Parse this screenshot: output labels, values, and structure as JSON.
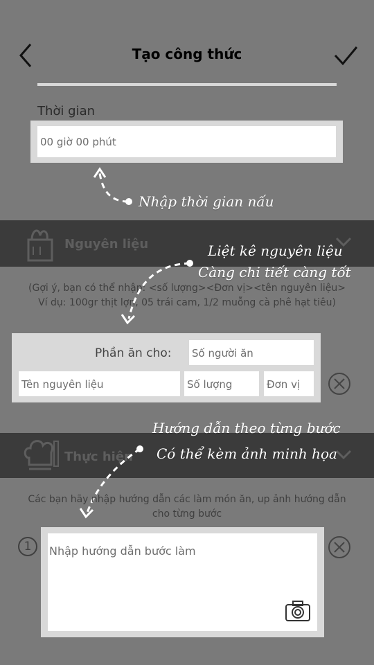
{
  "header": {
    "title": "Tạo công thức"
  },
  "time": {
    "label": "Thời gian",
    "placeholder": "00 giờ 00 phút"
  },
  "annotations": {
    "time_note": "Nhập thời gian nấu",
    "ingredient_note_line1": "Liệt kê nguyên liệu",
    "ingredient_note_line2": "Càng chi tiết càng tốt",
    "steps_note_line1": "Hướng dẫn theo từng bước",
    "steps_note_line2": "Có thể kèm ảnh minh họa"
  },
  "ingredients": {
    "section_title": "Nguyên liệu",
    "hint": "(Gợi ý, bạn có thể nhập: <số lượng><Đơn vị><tên nguyên liệu> Ví dụ: 100gr thịt lợn, 05 trái cam, 1/2 muỗng cà phê hạt tiêu)",
    "servings_label": "Phần ăn cho:",
    "servings_placeholder": "Số người ăn",
    "name_placeholder": "Tên nguyên liệu",
    "quantity_placeholder": "Số lượng",
    "unit_placeholder": "Đơn vị"
  },
  "steps": {
    "section_title": "Thực hiện",
    "hint": "Các bạn hãy nhập hướng dẫn các làm món ăn, up ảnh hướng dẫn cho từng bước",
    "step_number": "1",
    "step_placeholder": "Nhập hướng dẫn bước làm"
  },
  "icons": {
    "back": "chevron-left-icon",
    "done": "checkmark-icon",
    "ingredients": "grocery-bag-icon",
    "steps": "chef-hat-icon",
    "expand": "chevron-down-icon",
    "remove": "close-circle-icon",
    "camera": "camera-icon"
  }
}
